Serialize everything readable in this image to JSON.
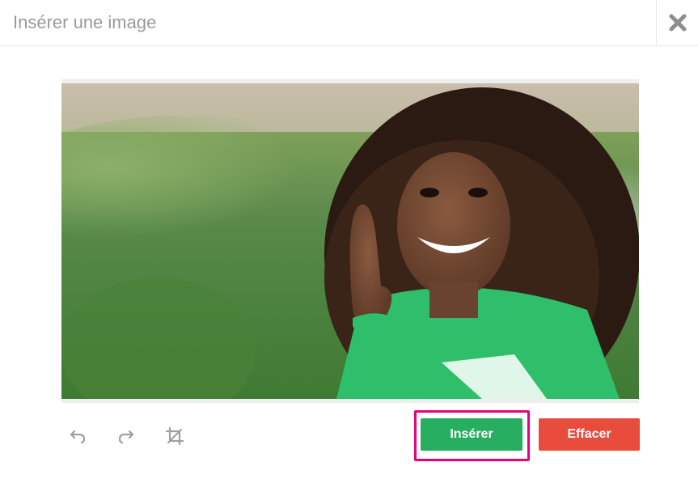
{
  "dialog": {
    "title": "Insérer une image",
    "close_icon": "close-icon"
  },
  "image": {
    "alt": "Girl in green t-shirt giving thumbs up",
    "description_colors": {
      "background": "#4f8a3a",
      "shirt": "#2fbf6a"
    }
  },
  "toolbar": {
    "undo_icon": "undo-icon",
    "redo_icon": "redo-icon",
    "crop_icon": "crop-icon"
  },
  "actions": {
    "insert_label": "Insérer",
    "clear_label": "Effacer"
  },
  "colors": {
    "insert": "#27ae60",
    "clear": "#e74c3c",
    "highlight": "#e6007e"
  }
}
